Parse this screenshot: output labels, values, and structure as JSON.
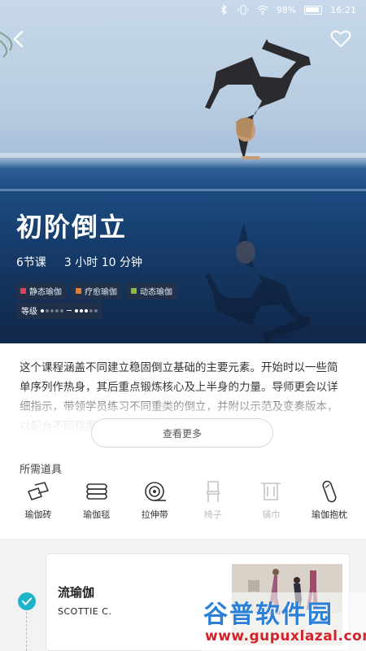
{
  "status_bar": {
    "battery": "98%",
    "time": "16:21"
  },
  "hero": {
    "title": "初阶倒立",
    "lessons": "6节课",
    "duration": "3 小时 10 分钟",
    "tags": [
      {
        "label": "静态瑜伽",
        "color": "#d9425a"
      },
      {
        "label": "疗愈瑜伽",
        "color": "#e57a2c"
      },
      {
        "label": "动态瑜伽",
        "color": "#8dbb3a"
      }
    ],
    "level_label": "等级"
  },
  "description": {
    "text": "这个课程涵盖不同建立稳固倒立基础的主要元素。开始时以一些简单序列作热身，其后重点锻炼核心及上半身的力量。导师更会以详细指示，带领学员练习不同重类的倒立，并附以示范及变奏版本，以配合不同程度的学员",
    "more_label": "查看更多"
  },
  "props": {
    "title": "所需道具",
    "items": [
      {
        "label": "瑜伽砖",
        "icon": "yoga-block-icon",
        "available": true
      },
      {
        "label": "瑜伽毯",
        "icon": "yoga-blanket-icon",
        "available": true
      },
      {
        "label": "拉伸带",
        "icon": "strap-icon",
        "available": true
      },
      {
        "label": "椅子",
        "icon": "chair-icon",
        "available": false
      },
      {
        "label": "铺巾",
        "icon": "towel-icon",
        "available": false
      },
      {
        "label": "瑜伽抱枕",
        "icon": "bolster-icon",
        "available": true
      }
    ]
  },
  "lesson": {
    "name": "流瑜伽",
    "teacher": "SCOTTIE C."
  },
  "watermark": {
    "main": "谷普软件园",
    "url": "www.gupuxlazal.com"
  },
  "colors": {
    "accent": "#1fb4c9",
    "sky": "#c6d8e9",
    "water": "#1b4a80"
  }
}
